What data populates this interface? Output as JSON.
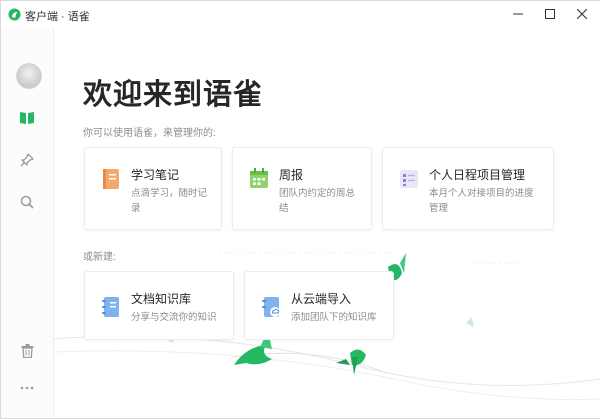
{
  "window": {
    "title": "客户端 · 语雀",
    "controls": [
      "minimize-icon",
      "maximize-icon",
      "close-icon"
    ]
  },
  "sidebar": {
    "items": [
      {
        "icon": "avatar"
      },
      {
        "icon": "book-icon",
        "active": true
      },
      {
        "icon": "pin-icon"
      },
      {
        "icon": "search-icon"
      },
      {
        "icon": "trash-icon"
      },
      {
        "icon": "more-icon"
      }
    ]
  },
  "main": {
    "title": "欢迎来到语雀",
    "subtitle": "你可以使用语雀，来管理你的:",
    "templates": [
      {
        "title": "学习笔记",
        "desc": "点滴学习，随时记录",
        "icon": "notebook-icon"
      },
      {
        "title": "周报",
        "desc": "团队内约定的周总结",
        "icon": "calendar-icon"
      },
      {
        "title": "个人日程项目管理",
        "desc": "本月个人对接项目的进度管理",
        "icon": "checklist-icon"
      }
    ],
    "new_label": "或新建:",
    "create": [
      {
        "title": "文档知识库",
        "desc": "分享与交流你的知识",
        "icon": "knowledge-base-icon"
      },
      {
        "title": "从云端导入",
        "desc": "添加团队下的知识库",
        "icon": "cloud-import-icon"
      }
    ]
  },
  "colors": {
    "brand_green": "#25b864",
    "sidebar_active": "#25b864",
    "icon_gray": "#8c8c8c",
    "notebook_orange": "#f4a460",
    "knowledge_blue": "#6aa8e8"
  }
}
